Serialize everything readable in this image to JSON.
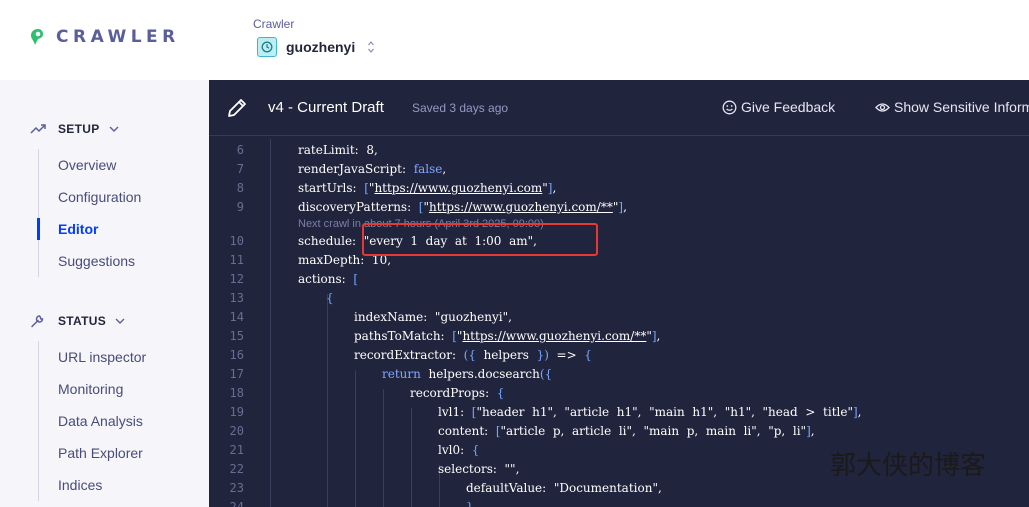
{
  "brand": {
    "name": "CRAWLER",
    "accent": "#2fbf71"
  },
  "app_switcher": {
    "label": "Crawler",
    "app_name": "guozhenyi",
    "icon": "clock-icon"
  },
  "sidebar": {
    "setup": {
      "heading": "SETUP",
      "icon": "trend-icon",
      "items": [
        {
          "label": "Overview",
          "active": false
        },
        {
          "label": "Configuration",
          "active": false
        },
        {
          "label": "Editor",
          "active": true
        },
        {
          "label": "Suggestions",
          "active": false
        }
      ]
    },
    "status": {
      "heading": "STATUS",
      "icon": "wrench-icon",
      "items": [
        {
          "label": "URL inspector"
        },
        {
          "label": "Monitoring"
        },
        {
          "label": "Data Analysis"
        },
        {
          "label": "Path Explorer"
        },
        {
          "label": "Indices"
        }
      ]
    }
  },
  "editor": {
    "title": "v4 - Current Draft",
    "saved": "Saved 3 days ago",
    "feedback_label": "Give Feedback",
    "sensitive_label": "Show Sensitive Inform",
    "crawl_hint": "Next crawl in about 7 hours (April 3rd 2025, 09:00)",
    "lines": [
      {
        "n": "6",
        "t": "rateLimit:  8,"
      },
      {
        "n": "7",
        "t": "renderJavaScript:  false,"
      },
      {
        "n": "8",
        "t": "startUrls:  [\"https://www.guozhenyi.com\"],"
      },
      {
        "n": "9",
        "t": "discoveryPatterns:  [\"https://www.guozhenyi.com/**\"],"
      },
      {
        "n": "10",
        "t": "schedule:  \"every  1  day  at  1:00  am\","
      },
      {
        "n": "11",
        "t": "maxDepth:  10,"
      },
      {
        "n": "12",
        "t": "actions:  ["
      },
      {
        "n": "13",
        "t": "{"
      },
      {
        "n": "14",
        "t": "indexName:  \"guozhenyi\","
      },
      {
        "n": "15",
        "t": "pathsToMatch:  [\"https://www.guozhenyi.com/**\"],"
      },
      {
        "n": "16",
        "t": "recordExtractor:  ({  helpers  })  =>  {"
      },
      {
        "n": "17",
        "t": "return  helpers.docsearch({"
      },
      {
        "n": "18",
        "t": "recordProps:  {"
      },
      {
        "n": "19",
        "t": "lvl1:  [\"header  h1\",  \"article  h1\",  \"main  h1\",  \"h1\",  \"head  >  title\"],"
      },
      {
        "n": "20",
        "t": "content:  [\"article  p,  article  li\",  \"main  p,  main  li\",  \"p,  li\"],"
      },
      {
        "n": "21",
        "t": "lvl0:  {"
      },
      {
        "n": "22",
        "t": "selectors:  \"\","
      },
      {
        "n": "23",
        "t": "defaultValue:  \"Documentation\","
      },
      {
        "n": "24",
        "t": "},"
      }
    ]
  },
  "watermark": "郭大侠的博客"
}
